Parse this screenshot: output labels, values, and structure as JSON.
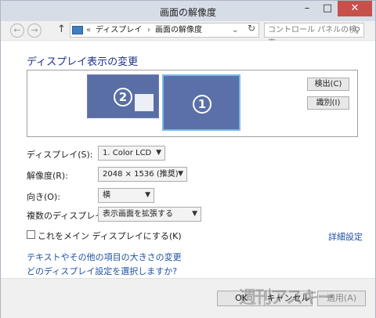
{
  "window": {
    "title": "画面の解像度",
    "minimize": "–",
    "maximize": "□",
    "close": "✕"
  },
  "nav": {
    "back_icon": "←",
    "forward_icon": "→",
    "up_icon": "↑",
    "breadcrumb_prefix": "«",
    "breadcrumb": [
      "ディスプレイ",
      "画面の解像度"
    ],
    "separator": "›",
    "dropdown_icon": "⌄",
    "refresh_icon": "↻",
    "search_placeholder": "コントロール パネルの検索",
    "search_icon": "⚲"
  },
  "main": {
    "heading": "ディスプレイ表示の変更",
    "monitors": [
      {
        "number": "2",
        "selected": false
      },
      {
        "number": "1",
        "selected": true
      }
    ],
    "detect_label": "検出(C)",
    "identify_label": "識別(I)",
    "fields": [
      {
        "label": "ディスプレイ(S):",
        "value": "1. Color LCD"
      },
      {
        "label": "解像度(R):",
        "value": "2048 × 1536 (推奨)"
      },
      {
        "label": "向き(O):",
        "value": "横"
      },
      {
        "label": "複数のディスプレイ(M):",
        "value": "表示画面を拡張する"
      }
    ],
    "main_display_checkbox": "これをメイン ディスプレイにする(K)",
    "advanced_link": "詳細設定",
    "links": [
      "テキストやその他の項目の大きさの変更",
      "どのディスプレイ設定を選択しますか?"
    ]
  },
  "footer": {
    "ok": "OK",
    "cancel": "キャンセル",
    "apply": "適用(A)",
    "watermark": "週刊アスキー"
  },
  "colors": {
    "accent": "#1e3287",
    "monitor": "#5a6ea6",
    "selected_outline": "#7ab8e8",
    "link": "#1e50a2",
    "close": "#c7504b"
  }
}
